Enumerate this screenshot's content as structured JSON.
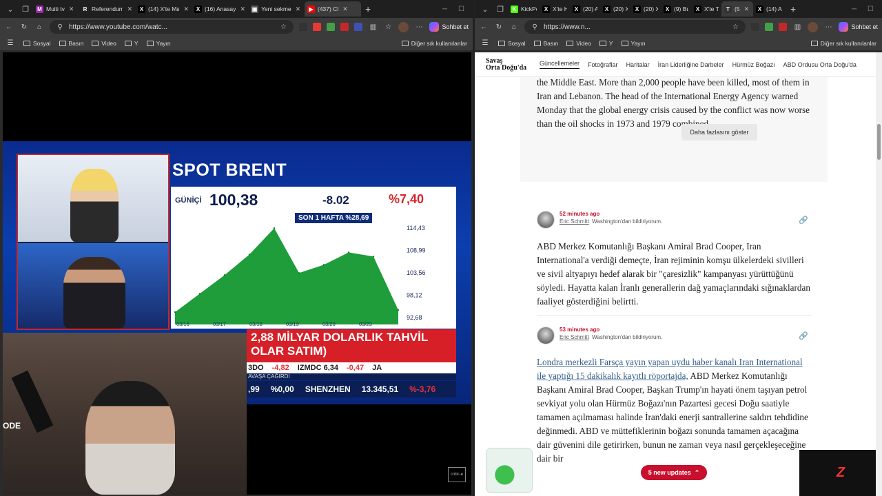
{
  "left_window": {
    "tabs": [
      {
        "title": "Multi tv",
        "color": "#9c27b0",
        "glyph": "M"
      },
      {
        "title": "Referendum",
        "color": "#222222",
        "glyph": "R"
      },
      {
        "title": "(14) X'te Ma",
        "color": "#000000",
        "glyph": "X"
      },
      {
        "title": "(16) Anasayf",
        "color": "#000000",
        "glyph": "X"
      },
      {
        "title": "Yeni sekme",
        "color": "#555555",
        "glyph": "▣"
      },
      {
        "title": "(437) Cl",
        "color": "#ff0000",
        "glyph": "▶"
      }
    ],
    "url": "https://www.youtube.com/watc...",
    "copilot": "Sohbet et",
    "bookmarks": [
      "Sosyal",
      "Basın",
      "Video",
      "Y",
      "Yayın"
    ],
    "bookmarks_other": "Diğer sık kullanılanlar"
  },
  "tv": {
    "title": "SPOT BRENT",
    "daily_label": "GÜNİÇİ",
    "price": "100,38",
    "change": "-8.02",
    "percent": "%7,40",
    "week_label": "SON 1 HAFTA",
    "week_pct": "%28,69",
    "y_ticks": [
      "114,43",
      "108,99",
      "103,56",
      "98,12",
      "92,68"
    ],
    "x_ticks": [
      "03/16",
      "03/17",
      "03/18",
      "03/19",
      "03/20",
      "03/23"
    ],
    "ticker_headline_1": "2,88 MİLYAR DOLARLIK TAHVİL",
    "ticker_headline_2": "OLAR SATIM)",
    "ticker_row": [
      {
        "text": "3DO",
        "cls": ""
      },
      {
        "text": "-4,82",
        "cls": "red"
      },
      {
        "text": "IZMDC 6,34",
        "cls": ""
      },
      {
        "text": "-0,47",
        "cls": "red"
      },
      {
        "text": "JA",
        "cls": ""
      }
    ],
    "ticker_strip": "AVAŞA ÇAĞIRDI",
    "market_row": [
      {
        "text": ",99",
        "cls": ""
      },
      {
        "text": "%0,00",
        "cls": ""
      },
      {
        "text": "SHENZHEN",
        "cls": ""
      },
      {
        "text": "13.345,51",
        "cls": ""
      },
      {
        "text": "%-3,76",
        "cls": "red"
      }
    ],
    "cam_label": "ODE",
    "watermark": "cnbc-e",
    "chart_data": {
      "type": "area",
      "x": [
        "03/16",
        "03/17",
        "03/18",
        "03/19",
        "03/20",
        "03/23"
      ],
      "series": [
        {
          "values": [
            94.0,
            98.5,
            103.0,
            108.0,
            114.4,
            103.5,
            105.5,
            108.5,
            107.5,
            94.5
          ]
        }
      ],
      "ylim": [
        92.68,
        114.43
      ],
      "color": "#1e9d3a"
    }
  },
  "right_window": {
    "tabs": [
      {
        "title": "KickPe",
        "color": "#53fc18",
        "glyph": "K"
      },
      {
        "title": "X'te H",
        "color": "#000000",
        "glyph": "X"
      },
      {
        "title": "(20) A",
        "color": "#000000",
        "glyph": "X"
      },
      {
        "title": "(20) X",
        "color": "#000000",
        "glyph": "X"
      },
      {
        "title": "(20) X",
        "color": "#000000",
        "glyph": "X"
      },
      {
        "title": "(9) Bu",
        "color": "#000000",
        "glyph": "X"
      },
      {
        "title": "X'te T",
        "color": "#000000",
        "glyph": "X"
      },
      {
        "title": "(5",
        "color": "#333333",
        "glyph": "T"
      },
      {
        "title": "(14) A",
        "color": "#000000",
        "glyph": "X"
      }
    ],
    "url": "https://www.n...",
    "copilot": "Sohbet et",
    "bookmarks": [
      "Sosyal",
      "Basın",
      "Video",
      "Y",
      "Yayın"
    ],
    "bookmarks_other": "Diğer sık kullanılanlar"
  },
  "article": {
    "brand_line1": "Savaş",
    "brand_line2": "Orta Doğu'da",
    "nav": [
      "Güncellemeler",
      "Fotoğraflar",
      "Haritalar",
      "İran Liderliğine Darbeler",
      "Hürmüz Boğazı",
      "ABD Ordusu Orta Doğu'da"
    ],
    "card_text": "the Middle East. More than 2,000 people have been killed, most of them in Iran and Lebanon. The head of the International Energy Agency warned Monday that the global energy crisis caused by the conflict was now worse than the oil shocks in 1973 and 1979 combined.",
    "show_more": "Daha fazlasını göster",
    "entries": [
      {
        "time": "52 minutes ago",
        "author": "Eric Schmitt",
        "location": "Washington'dan bildiriyorum.",
        "link": "",
        "body": "ABD Merkez Komutanlığı Başkanı Amiral Brad Cooper, Iran International'a verdiği demeçte, İran rejiminin komşu ülkelerdeki sivilleri ve sivil altyapıyı hedef alarak bir \"çaresizlik\" kampanyası yürüttüğünü söyledi. Hayatta kalan İranlı generallerin dağ yamaçlarındaki sığınaklardan faaliyet gösterdiğini belirtti."
      },
      {
        "time": "53 minutes ago",
        "author": "Eric Schmitt",
        "location": "Washington'dan bildiriyorum.",
        "link": "Londra merkezli Farsça yayın yapan uydu haber kanalı Iran International ile yaptığı 15 dakikalık kayıtlı röportajda,",
        "body": " ABD Merkez Komutanlığı Başkanı Amiral Brad Cooper, Başkan Trump'ın hayati önem taşıyan petrol sevkiyat yolu olan Hürmüz Boğazı'nın Pazartesi gecesi Doğu saatiyle tamamen açılmaması halinde İran'daki enerji santrallerine saldırı tehdidine değinmedi. ABD ve müttefiklerinin boğazı sonunda tamamen açacağına dair güvenini dile getirirken, bunun ne zaman veya nasıl gerçekleşeceğine dair bir"
      }
    ],
    "updates_label": "5 new updates"
  }
}
